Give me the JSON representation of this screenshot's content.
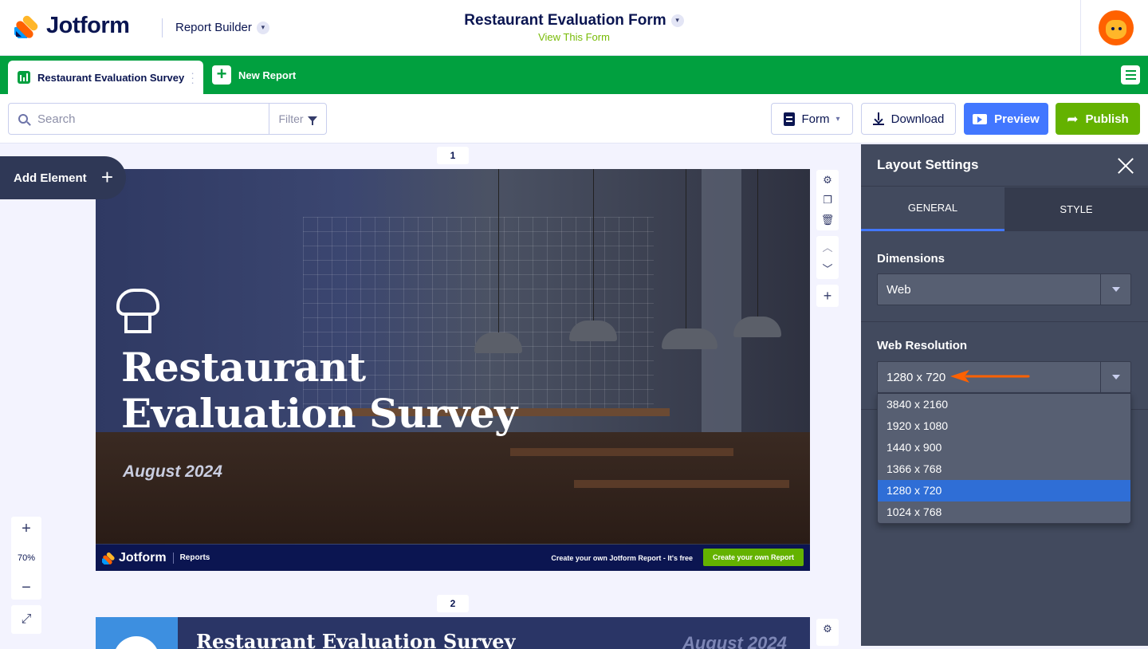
{
  "header": {
    "logo_text": "Jotform",
    "app_name": "Report Builder",
    "form_title": "Restaurant Evaluation Form",
    "view_form": "View This Form"
  },
  "tabs": {
    "active_tab": "Restaurant Evaluation Survey",
    "new_report": "New Report"
  },
  "toolbar": {
    "search_placeholder": "Search",
    "filter": "Filter",
    "form": "Form",
    "download": "Download",
    "preview": "Preview",
    "publish": "Publish"
  },
  "canvas": {
    "add_element": "Add Element",
    "zoom": "70%",
    "pages": [
      {
        "number": "1",
        "title_line1": "Restaurant",
        "title_line2": "Evaluation Survey",
        "date": "August 2024",
        "footer_logo": "Jotform",
        "footer_reports": "Reports",
        "footer_cta_text": "Create your own Jotform Report - It's free",
        "footer_cta_button": "Create your own Report"
      },
      {
        "number": "2",
        "title": "Restaurant Evaluation Survey",
        "date": "August 2024"
      }
    ]
  },
  "panel": {
    "title": "Layout Settings",
    "tabs": [
      "GENERAL",
      "STYLE"
    ],
    "dimensions_label": "Dimensions",
    "dimensions_value": "Web",
    "resolution_label": "Web Resolution",
    "resolution_value": "1280 x 720",
    "resolution_options": [
      "3840 x 2160",
      "1920 x 1080",
      "1440 x 900",
      "1366 x 768",
      "1280 x 720",
      "1024 x 768"
    ],
    "selected_index": 4
  },
  "colors": {
    "brand_green": "#01a03f",
    "preview_blue": "#4277ff",
    "publish_green": "#64b200",
    "panel_bg": "#424a5e",
    "selected_option": "#2f6ed6",
    "annotation_arrow": "#ff6100"
  }
}
